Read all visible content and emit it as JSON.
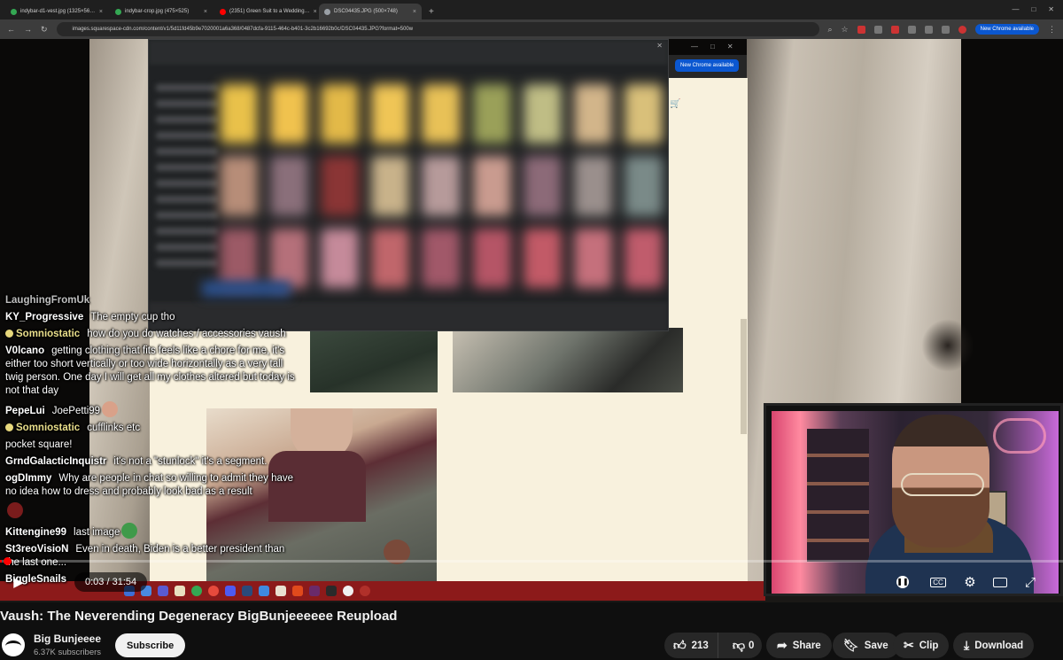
{
  "captured_browser": {
    "tabs": [
      {
        "label": "indybar-d1-vest.jpg (1325×56…",
        "favicon_color": "#34a853"
      },
      {
        "label": "indybar-crop.jpg (475×525)",
        "favicon_color": "#34a853"
      },
      {
        "label": "(2351) Green Suit to a Wedding…",
        "favicon_color": "#ff0000"
      },
      {
        "label": "DSC04435.JPG (500×748)",
        "favicon_color": "#9aa0a6"
      }
    ],
    "url": "images.squarespace-cdn.com/content/v1/5d11fd45b9e7020001a6a368/0487dcfa-9115-464c-b401-3c2b16692b0c/DSC04435.JPG?format=500w",
    "update_button": "New Chrome available",
    "inner_update_button": "New Chrome available"
  },
  "chat": [
    {
      "user": "LaughingFromUk",
      "text": "",
      "color": "#bfbfbf"
    },
    {
      "user": "KY_Progressive",
      "text": "The empty cup tho",
      "color": "#ffffff"
    },
    {
      "user": "Somniostatic",
      "text": "how do you do watches / accessories vaush",
      "color": "#e8dd8a",
      "badge": true
    },
    {
      "user": "V0lcano",
      "text": "getting clothing that fits feels like a chore for me, it's either too short vertically or too wide horizontally as a very tall twig person. One day I will get all my clothes altered but today is not that day",
      "color": "#ffffff"
    },
    {
      "user": "PepeLui",
      "text": "JoePetti99",
      "color": "#ffffff",
      "emote": "#d9a189"
    },
    {
      "user": "Somniostatic",
      "text": "cufflinks etc",
      "color": "#e8dd8a",
      "badge": true
    },
    {
      "user": "",
      "text": "pocket square!",
      "color": "#ffffff"
    },
    {
      "user": "GrndGalacticInquistr",
      "text": "it's not a \"stunlock\" it's a segment.",
      "color": "#ffffff"
    },
    {
      "user": "ogDImmy",
      "text": "Why are people in chat so willing to admit they have no idea how to dress and probably look bad as a result",
      "color": "#ffffff"
    },
    {
      "user": "",
      "text": "",
      "color": "#ffffff",
      "emote": "#7a1c1c"
    },
    {
      "user": "Kittengine99",
      "text": "last image",
      "color": "#ffffff",
      "emote": "#3f9a4a"
    },
    {
      "user": "St3reoVisioN",
      "text": "Even in death, Biden is a better president than the last one...",
      "color": "#ffffff"
    },
    {
      "user": "BiggleSnails",
      "text": "",
      "color": "#ffffff"
    }
  ],
  "player": {
    "time": "0:03 / 31:54",
    "progress": 0.0016,
    "play_icon": "play-icon",
    "cc_label": "CC",
    "settings_icon": "gear-icon"
  },
  "video": {
    "title": "Vaush: The Neverending Degeneracy BigBunjeeeeee Reupload"
  },
  "channel": {
    "name": "Big Bunjeeee",
    "subscribers": "6.37K subscribers",
    "subscribe_label": "Subscribe"
  },
  "actions": {
    "likes": "213",
    "dislikes": "0",
    "share": "Share",
    "save": "Save",
    "clip": "Clip",
    "download": "Download"
  },
  "colors": {
    "accent": "#ff0000",
    "background": "#0f0f0f",
    "button_bg": "#272727"
  }
}
